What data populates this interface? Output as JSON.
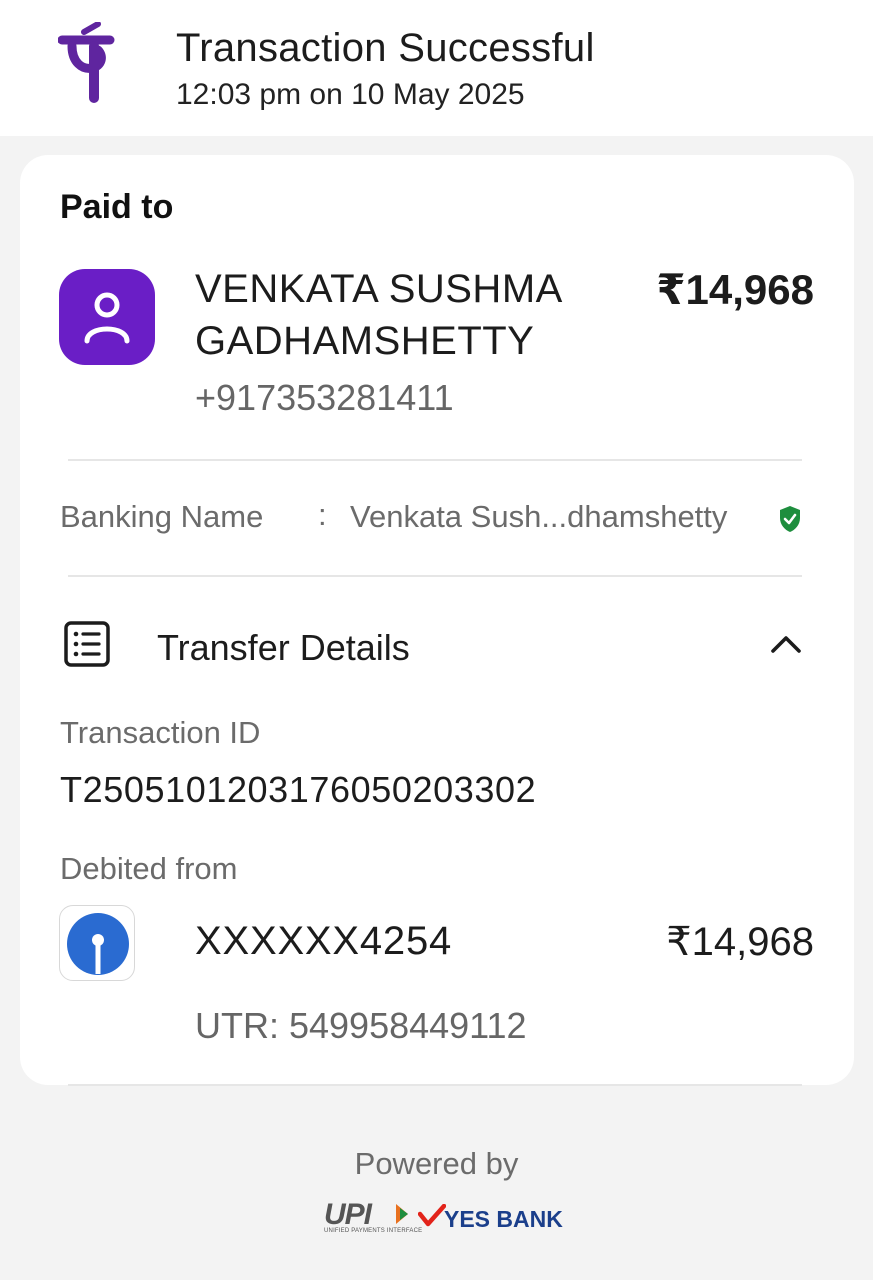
{
  "header": {
    "logo_icon": "phonepe-logo-icon",
    "title": "Transaction Successful",
    "datetime": "12:03 pm on 10 May 2025"
  },
  "payment": {
    "paid_to_label": "Paid to",
    "avatar_icon": "user-icon",
    "payee_name_line1": "VENKATA SUSHMA",
    "payee_name_line2": "GADHAMSHETTY",
    "payee_phone": "+917353281411",
    "amount": "₹14,968"
  },
  "banking": {
    "label": "Banking Name",
    "separator": ":",
    "value": "Venkata Sush...dhamshetty",
    "verified_icon": "verified-shield-icon"
  },
  "transfer": {
    "icon": "list-details-icon",
    "title": "Transfer Details",
    "toggle_icon": "chevron-up-icon",
    "transaction_id_label": "Transaction ID",
    "transaction_id": "T2505101203176050203302",
    "debited_from_label": "Debited from",
    "bank_icon": "sbi-bank-icon",
    "account": "XXXXXX4254",
    "debit_amount": "₹14,968",
    "utr": "UTR: 549958449112"
  },
  "footer": {
    "powered_by": "Powered by",
    "upi_logo": "UPI",
    "upi_tagline": "UNIFIED PAYMENTS INTERFACE",
    "bank_logo": "YES BANK"
  },
  "colors": {
    "brand_purple": "#5f259f",
    "avatar_purple": "#6a1ec6",
    "sbi_blue": "#2a6bd1",
    "verified_green": "#1e8e3e",
    "yes_bank_blue": "#1b3f8b",
    "yes_bank_red": "#e2231a"
  }
}
